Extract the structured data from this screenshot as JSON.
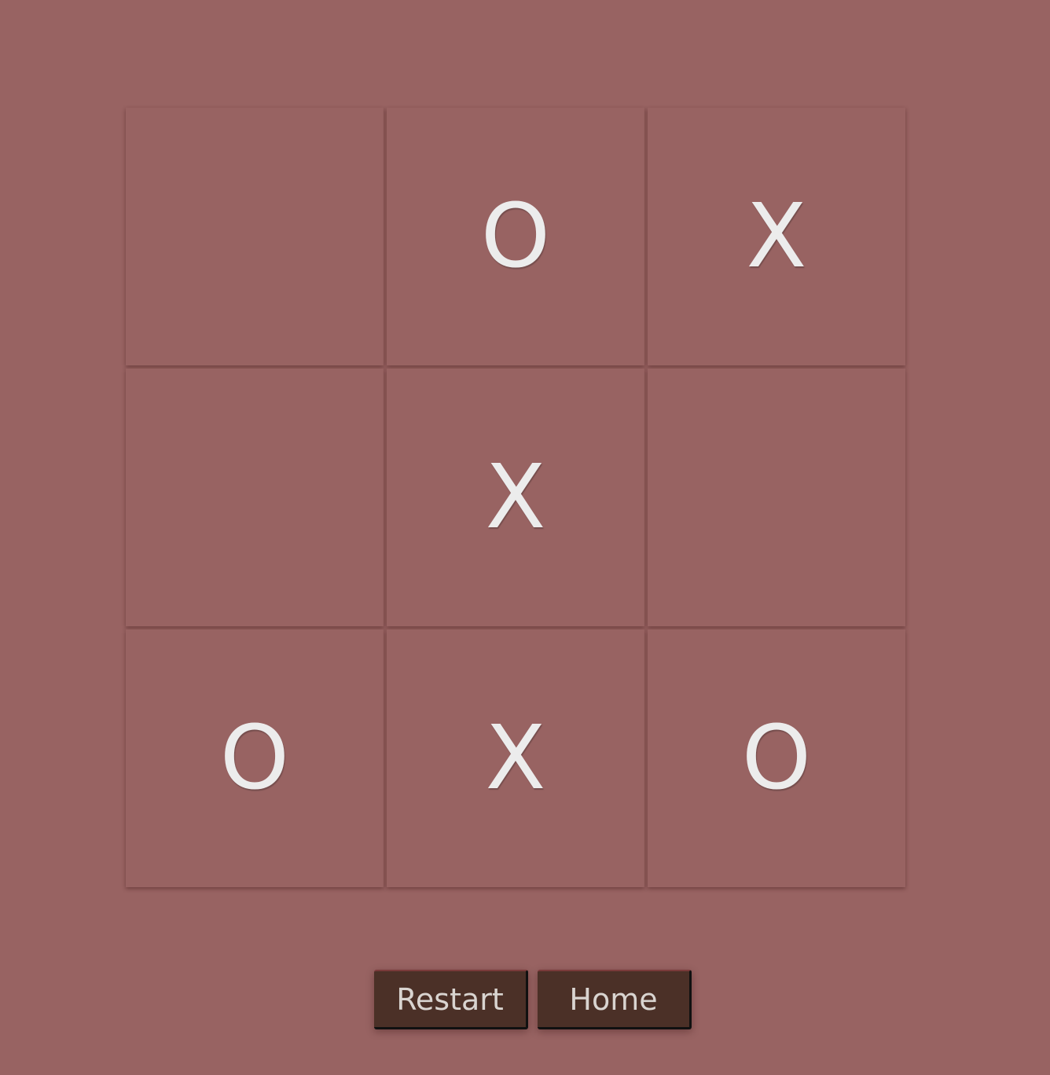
{
  "board": {
    "cells": [
      "",
      "O",
      "X",
      "",
      "X",
      "",
      "O",
      "X",
      "O"
    ]
  },
  "controls": {
    "restart_label": "Restart",
    "home_label": "Home"
  },
  "colors": {
    "background": "#986362",
    "mark": "#ececec",
    "button_bg": "#4b3027",
    "button_text": "#d9d4d0"
  }
}
